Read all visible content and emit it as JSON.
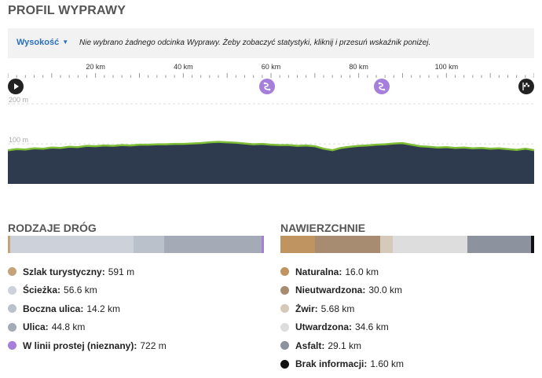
{
  "title": "PROFIL WYPRAWY",
  "infobar": {
    "dropdown_label": "Wysokość",
    "message": "Nie wybrano żadnego odcinka Wyprawy. Żeby zobaczyć statystyki, kliknij i przesuń wskaźnik poniżej."
  },
  "axis_ticks": [
    "20 km",
    "40 km",
    "60 km",
    "80 km",
    "100 km"
  ],
  "markers": {
    "start_icon": "play-icon",
    "end_icon": "finish-flag-icon",
    "waypoint_icon": "route-icon"
  },
  "chart_data": {
    "type": "area",
    "ylabel": "",
    "y_tick_labels": [
      "200 m",
      "100 m"
    ],
    "x_km": [
      0,
      2,
      4,
      6,
      8,
      10,
      12,
      14,
      16,
      18,
      20,
      22,
      24,
      26,
      28,
      30,
      32,
      34,
      36,
      38,
      40,
      42,
      44,
      46,
      48,
      50,
      52,
      54,
      56,
      58,
      60,
      62,
      64,
      66,
      68,
      70,
      72,
      74,
      76,
      78,
      80,
      82,
      84,
      86,
      88,
      90,
      92,
      94,
      96,
      98,
      100,
      102,
      104,
      106,
      108,
      110,
      112,
      114,
      116,
      118,
      120
    ],
    "elevation_m": [
      84,
      87,
      86,
      89,
      88,
      91,
      90,
      93,
      92,
      95,
      94,
      96,
      95,
      97,
      96,
      98,
      98,
      99,
      99,
      100,
      100,
      101,
      102,
      104,
      105,
      104,
      103,
      101,
      99,
      100,
      98,
      97,
      97,
      95,
      96,
      94,
      88,
      84,
      90,
      93,
      95,
      96,
      98,
      99,
      101,
      102,
      98,
      94,
      93,
      91,
      92,
      90,
      91,
      89,
      90,
      88,
      89,
      87,
      85,
      88,
      84
    ],
    "xlim": [
      0,
      120
    ],
    "ylim": [
      0,
      220
    ],
    "area_color": "#2e3a4d",
    "line_color": "#7cbd35",
    "grid": true
  },
  "road_types": {
    "title": "RODZAJE DRÓG",
    "items": [
      {
        "label": "Szlak turystyczny:",
        "value": "591 m",
        "km": 0.591,
        "color": "#c4a37a"
      },
      {
        "label": "Ścieżka:",
        "value": "56.6 km",
        "km": 56.6,
        "color": "#cdd2da"
      },
      {
        "label": "Boczna ulica:",
        "value": "14.2 km",
        "km": 14.2,
        "color": "#bac1ca"
      },
      {
        "label": "Ulica:",
        "value": "44.8 km",
        "km": 44.8,
        "color": "#a4abb6"
      },
      {
        "label": "W linii prostej (nieznany):",
        "value": "722 m",
        "km": 0.722,
        "color": "#a57fd9"
      }
    ]
  },
  "surfaces": {
    "title": "NAWIERZCHNIE",
    "items": [
      {
        "label": "Naturalna:",
        "value": "16.0 km",
        "km": 16.0,
        "color": "#c09460"
      },
      {
        "label": "Nieutwardzona:",
        "value": "30.0 km",
        "km": 30.0,
        "color": "#a88c72"
      },
      {
        "label": "Żwir:",
        "value": "5.68 km",
        "km": 5.68,
        "color": "#d5c9b9"
      },
      {
        "label": "Utwardzona:",
        "value": "34.6 km",
        "km": 34.6,
        "color": "#dddddd"
      },
      {
        "label": "Asfalt:",
        "value": "29.1 km",
        "km": 29.1,
        "color": "#8c939e"
      },
      {
        "label": "Brak informacji:",
        "value": "1.60 km",
        "km": 1.6,
        "color": "#111111"
      }
    ]
  }
}
